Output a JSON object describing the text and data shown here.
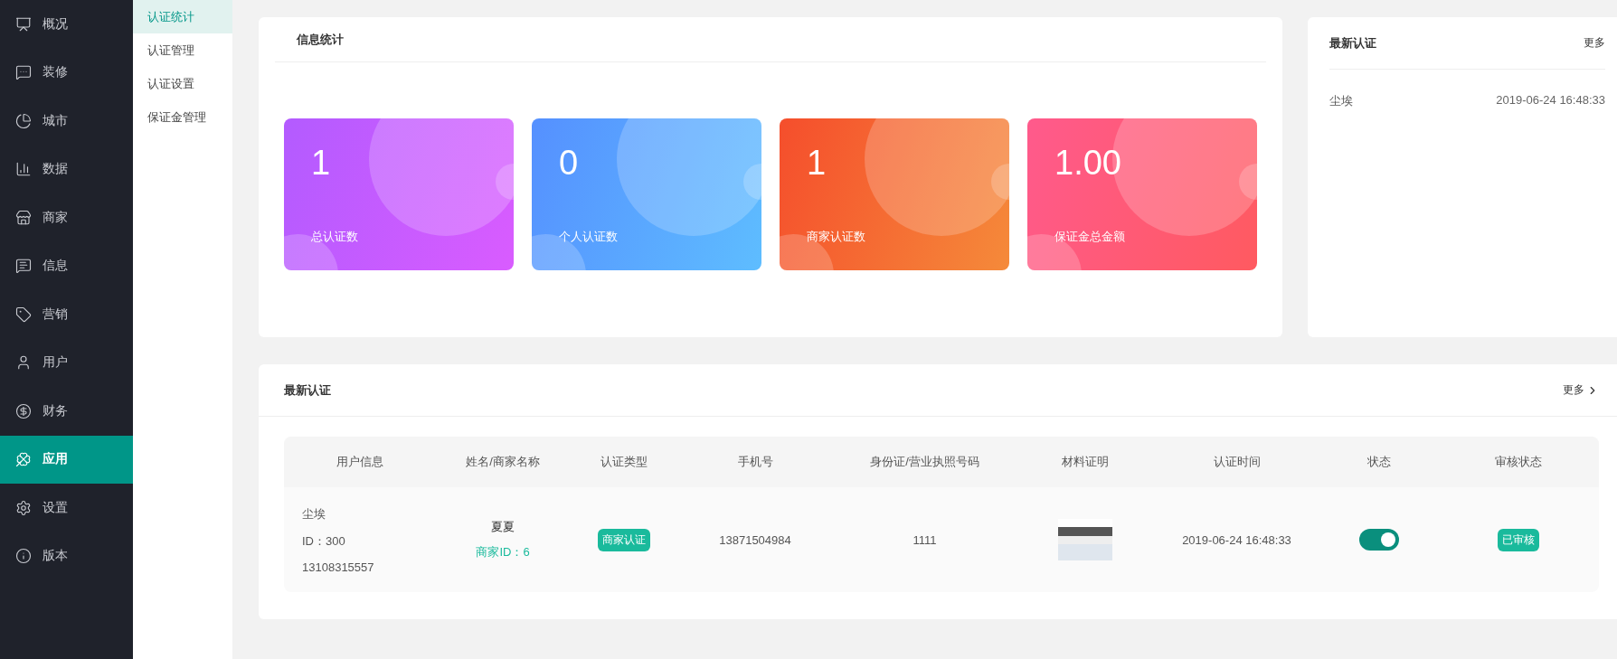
{
  "sidebar": {
    "items": [
      {
        "label": "概况",
        "selected": false
      },
      {
        "label": "装修",
        "selected": false
      },
      {
        "label": "城市",
        "selected": false
      },
      {
        "label": "数据",
        "selected": false
      },
      {
        "label": "商家",
        "selected": false
      },
      {
        "label": "信息",
        "selected": false
      },
      {
        "label": "营销",
        "selected": false
      },
      {
        "label": "用户",
        "selected": false
      },
      {
        "label": "财务",
        "selected": false
      },
      {
        "label": "应用",
        "selected": true
      },
      {
        "label": "设置",
        "selected": false
      },
      {
        "label": "版本",
        "selected": false
      }
    ]
  },
  "submenu": {
    "items": [
      {
        "label": "认证统计",
        "selected": true
      },
      {
        "label": "认证管理",
        "selected": false
      },
      {
        "label": "认证设置",
        "selected": false
      },
      {
        "label": "保证金管理",
        "selected": false
      }
    ]
  },
  "stats_panel": {
    "title": "信息统计",
    "cards": [
      {
        "value": "1",
        "label": "总认证数"
      },
      {
        "value": "0",
        "label": "个人认证数"
      },
      {
        "value": "1",
        "label": "商家认证数"
      },
      {
        "value": "1.00",
        "label": "保证金总金额"
      }
    ]
  },
  "latest_panel": {
    "title": "最新认证",
    "more": "更多",
    "items": [
      {
        "name": "尘埃",
        "time": "2019-06-24 16:48:33"
      }
    ]
  },
  "table_panel": {
    "title": "最新认证",
    "more": "更多",
    "columns": [
      "用户信息",
      "姓名/商家名称",
      "认证类型",
      "手机号",
      "身份证/营业执照号码",
      "材料证明",
      "认证时间",
      "状态",
      "审核状态"
    ],
    "rows": [
      {
        "user_name": "尘埃",
        "user_id": "ID：300",
        "user_phone": "13108315557",
        "name": "夏夏",
        "merchant_id": "商家ID：6",
        "type": "商家认证",
        "phone": "13871504984",
        "id_number": "1111",
        "time": "2019-06-24 16:48:33",
        "status_on": true,
        "review": "已审核"
      }
    ]
  }
}
